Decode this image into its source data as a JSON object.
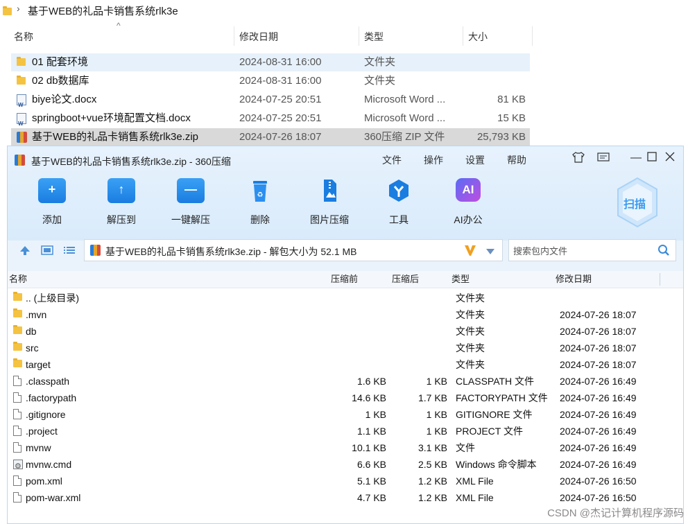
{
  "explorer": {
    "path": "基于WEB的礼品卡销售系统rlk3e",
    "columns": {
      "name": "名称",
      "date": "修改日期",
      "type": "类型",
      "size": "大小"
    },
    "rows": [
      {
        "name": "01 配套环境",
        "date": "2024-08-31 16:00",
        "type": "文件夹",
        "size": "",
        "icon": "folder-icon"
      },
      {
        "name": "02 db数据库",
        "date": "2024-08-31 16:00",
        "type": "文件夹",
        "size": "",
        "icon": "folder-icon"
      },
      {
        "name": "biye论文.docx",
        "date": "2024-07-25 20:51",
        "type": "Microsoft Word ...",
        "size": "81 KB",
        "icon": "word-doc-icon"
      },
      {
        "name": "springboot+vue环境配置文档.docx",
        "date": "2024-07-25 20:51",
        "type": "Microsoft Word ...",
        "size": "15 KB",
        "icon": "word-doc-icon"
      },
      {
        "name": "基于WEB的礼品卡销售系统rlk3e.zip",
        "date": "2024-07-26 18:07",
        "type": "360压缩 ZIP 文件",
        "size": "25,793 KB",
        "icon": "zip-archive-icon"
      }
    ]
  },
  "zipwin": {
    "title": "基于WEB的礼品卡销售系统rlk3e.zip - 360压缩",
    "menu": [
      "文件",
      "操作",
      "设置",
      "帮助"
    ],
    "toolbar": [
      {
        "label": "添加",
        "icon": "add-icon"
      },
      {
        "label": "解压到",
        "icon": "extract-to-icon"
      },
      {
        "label": "一键解压",
        "icon": "one-click-extract-icon"
      },
      {
        "label": "删除",
        "icon": "delete-icon"
      },
      {
        "label": "图片压缩",
        "icon": "image-compress-icon"
      },
      {
        "label": "工具",
        "icon": "tools-icon"
      },
      {
        "label": "AI办公",
        "icon": "ai-office-icon"
      }
    ],
    "scan_label": "扫描",
    "address": "基于WEB的礼品卡销售系统rlk3e.zip - 解包大小为 52.1 MB",
    "search_placeholder": "搜索包内文件",
    "columns": {
      "name": "名称",
      "before": "压缩前",
      "after": "压缩后",
      "type": "类型",
      "date": "修改日期"
    },
    "files": [
      {
        "name": ".. (上级目录)",
        "before": "",
        "after": "",
        "type": "文件夹",
        "date": "",
        "icon": "folder-icon"
      },
      {
        "name": ".mvn",
        "before": "",
        "after": "",
        "type": "文件夹",
        "date": "2024-07-26 18:07",
        "icon": "folder-icon"
      },
      {
        "name": "db",
        "before": "",
        "after": "",
        "type": "文件夹",
        "date": "2024-07-26 18:07",
        "icon": "folder-icon"
      },
      {
        "name": "src",
        "before": "",
        "after": "",
        "type": "文件夹",
        "date": "2024-07-26 18:07",
        "icon": "folder-icon"
      },
      {
        "name": "target",
        "before": "",
        "after": "",
        "type": "文件夹",
        "date": "2024-07-26 18:07",
        "icon": "folder-icon"
      },
      {
        "name": ".classpath",
        "before": "1.6 KB",
        "after": "1 KB",
        "type": "CLASSPATH 文件",
        "date": "2024-07-26 16:49",
        "icon": "file-icon"
      },
      {
        "name": ".factorypath",
        "before": "14.6 KB",
        "after": "1.7 KB",
        "type": "FACTORYPATH 文件",
        "date": "2024-07-26 16:49",
        "icon": "file-icon"
      },
      {
        "name": ".gitignore",
        "before": "1 KB",
        "after": "1 KB",
        "type": "GITIGNORE 文件",
        "date": "2024-07-26 16:49",
        "icon": "file-icon"
      },
      {
        "name": ".project",
        "before": "1.1 KB",
        "after": "1 KB",
        "type": "PROJECT 文件",
        "date": "2024-07-26 16:49",
        "icon": "file-icon"
      },
      {
        "name": "mvnw",
        "before": "10.1 KB",
        "after": "3.1 KB",
        "type": "文件",
        "date": "2024-07-26 16:49",
        "icon": "file-icon"
      },
      {
        "name": "mvnw.cmd",
        "before": "6.6 KB",
        "after": "2.5 KB",
        "type": "Windows 命令脚本",
        "date": "2024-07-26 16:49",
        "icon": "cmd-script-icon"
      },
      {
        "name": "pom.xml",
        "before": "5.1 KB",
        "after": "1.2 KB",
        "type": "XML File",
        "date": "2024-07-26 16:50",
        "icon": "file-icon"
      },
      {
        "name": "pom-war.xml",
        "before": "4.7 KB",
        "after": "1.2 KB",
        "type": "XML File",
        "date": "2024-07-26 16:50",
        "icon": "file-icon"
      }
    ]
  },
  "watermark": "CSDN @杰记计算机程序源码",
  "colors": {
    "accent": "#1a7de0",
    "titlebar": "#e7f2fd",
    "selection": "#e6f1fb",
    "selected_zip": "#d9d9d9"
  }
}
